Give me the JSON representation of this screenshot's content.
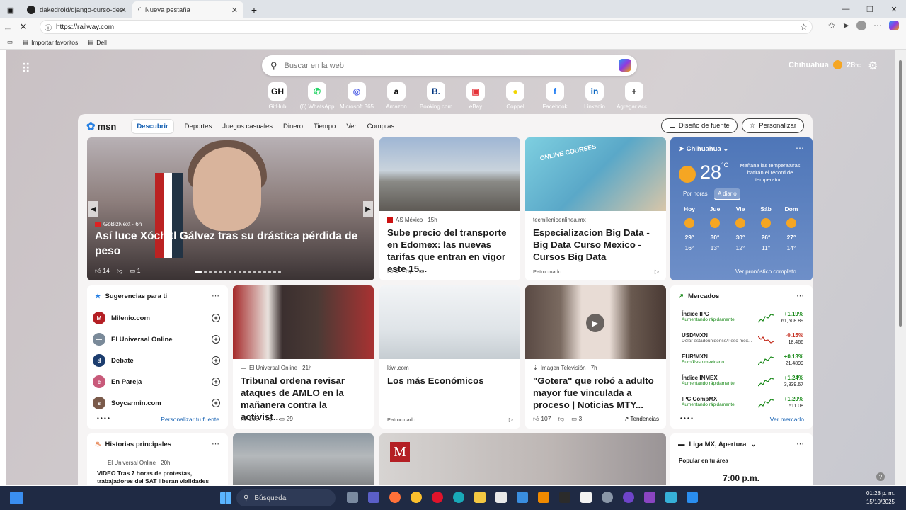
{
  "browser": {
    "tabs": [
      {
        "label": "dakedroid/django-curso-desarrollo",
        "icon": "github-icon"
      },
      {
        "label": "Nueva pestaña",
        "icon": "loading-icon"
      }
    ],
    "url": "https://railway.com",
    "favorites": [
      {
        "label": "Importar favoritos"
      },
      {
        "label": "Dell"
      }
    ]
  },
  "newtab": {
    "search_placeholder": "Buscar en la web",
    "location": "Chihuahua",
    "temp": "28",
    "temp_unit": "°C",
    "quick_links": [
      {
        "label": "GitHub",
        "glyph": "GH",
        "color": "#111111"
      },
      {
        "label": "(6) WhatsApp",
        "glyph": "✆",
        "color": "#25d366"
      },
      {
        "label": "Microsoft 365",
        "glyph": "◎",
        "color": "#5b6be8"
      },
      {
        "label": "Amazon",
        "glyph": "a",
        "color": "#111111"
      },
      {
        "label": "Booking.com",
        "glyph": "B.",
        "color": "#003580"
      },
      {
        "label": "eBay",
        "glyph": "▣",
        "color": "#e53238"
      },
      {
        "label": "Coppel",
        "glyph": "●",
        "color": "#f2d600"
      },
      {
        "label": "Facebook",
        "glyph": "f",
        "color": "#1877f2"
      },
      {
        "label": "Linkedin",
        "glyph": "in",
        "color": "#0a66c2"
      },
      {
        "label": "Agregar acc...",
        "glyph": "+",
        "color": "#333333"
      }
    ]
  },
  "feed": {
    "logo": "msn",
    "nav": [
      "Descubrir",
      "Deportes",
      "Juegos casuales",
      "Dinero",
      "Tiempo",
      "Ver",
      "Compras"
    ],
    "font_button": "Diseño de fuente",
    "personalize_button": "Personalizar",
    "hero": {
      "source": "GoBizNext · 6h",
      "title": "Así luce Xóchitl Gálvez tras su drástica pérdida de peso",
      "likes": "14",
      "comments": "1"
    },
    "card1": {
      "source": "AS México · 15h",
      "title": "Sube precio del transporte en Edomex: las nuevas tarifas que entran en vigor este 15...",
      "likes": "2"
    },
    "card2": {
      "source": "tecmilenioenlinea.mx",
      "title": "Especializacion Big Data - Big Data Curso Mexico - Cursos Big Data",
      "sponsored": "Patrocinado",
      "img_text": "ONLINE COURSES"
    },
    "weather": {
      "location": "Chihuahua",
      "temp": "28",
      "unit": "°C",
      "note": "Mañana las temperaturas batirán el récord de temperatur...",
      "tab_hourly": "Por horas",
      "tab_daily": "A diario",
      "days": [
        {
          "day": "Hoy",
          "hi": "29°",
          "lo": "16°"
        },
        {
          "day": "Jue",
          "hi": "30°",
          "lo": "13°"
        },
        {
          "day": "Vie",
          "hi": "30°",
          "lo": "12°"
        },
        {
          "day": "Sáb",
          "hi": "26°",
          "lo": "11°"
        },
        {
          "day": "Dom",
          "hi": "27°",
          "lo": "14°"
        }
      ],
      "forecast_link": "Ver pronóstico completo"
    },
    "suggestions": {
      "title": "Sugerencias para ti",
      "items": [
        {
          "label": "Milenio.com",
          "logo": "M",
          "color": "#b41f24"
        },
        {
          "label": "El Universal Online",
          "logo": "—",
          "color": "#7a8a99"
        },
        {
          "label": "Debate",
          "logo": "d",
          "color": "#1c3d6e"
        },
        {
          "label": "En Pareja",
          "logo": "e",
          "color": "#c85a7a"
        },
        {
          "label": "Soycarmin.com",
          "logo": "s",
          "color": "#7a5a4a"
        }
      ],
      "personalize_link": "Personalizar tu fuente"
    },
    "card3": {
      "source": "El Universal Online · 21h",
      "title": "Tribunal ordena revisar ataques de AMLO en la mañanera contra la activist...",
      "likes": "186",
      "comments": "29"
    },
    "card4": {
      "source": "kiwi.com",
      "title": "Los más Económicos",
      "sponsored": "Patrocinado"
    },
    "card5": {
      "source": "Imagen Televisión · 7h",
      "title": "\"Gotera\" que robó a adulto mayor fue vinculada a proceso | Noticias MTY...",
      "likes": "107",
      "comments": "3",
      "trend": "Tendencias"
    },
    "markets": {
      "title": "Mercados",
      "rows": [
        {
          "name": "Índice IPC",
          "sub": "Aumentando rápidamente",
          "pct": "+1.19%",
          "value": "61,508.89",
          "up": true
        },
        {
          "name": "USD/MXN",
          "sub": "Dólar estadounidense/Peso mex...",
          "pct": "-0.15%",
          "value": "18.466",
          "up": false
        },
        {
          "name": "EUR/MXN",
          "sub": "Euro/Peso mexicano",
          "pct": "+0.13%",
          "value": "21.4899",
          "up": true
        },
        {
          "name": "Índice INMEX",
          "sub": "Aumentando rápidamente",
          "pct": "+1.24%",
          "value": "3,839.67",
          "up": true
        },
        {
          "name": "IPC CompMX",
          "sub": "Aumentando rápidamente",
          "pct": "+1.20%",
          "value": "511.08",
          "up": true
        }
      ],
      "link": "Ver mercado"
    },
    "top_stories": {
      "title": "Historias principales",
      "source": "El Universal Online · 20h",
      "headline": "VIDEO Tras 7 horas de protestas, trabajadores del SAT liberan vialidades"
    },
    "league": {
      "title": "Liga MX, Apertura",
      "sub": "Popular en tu área",
      "time": "7:00 p.m."
    },
    "milenio_logo": "M"
  },
  "taskbar": {
    "search": "Búsqueda",
    "time": "01:28 p. m.",
    "date": "15/10/2025"
  }
}
